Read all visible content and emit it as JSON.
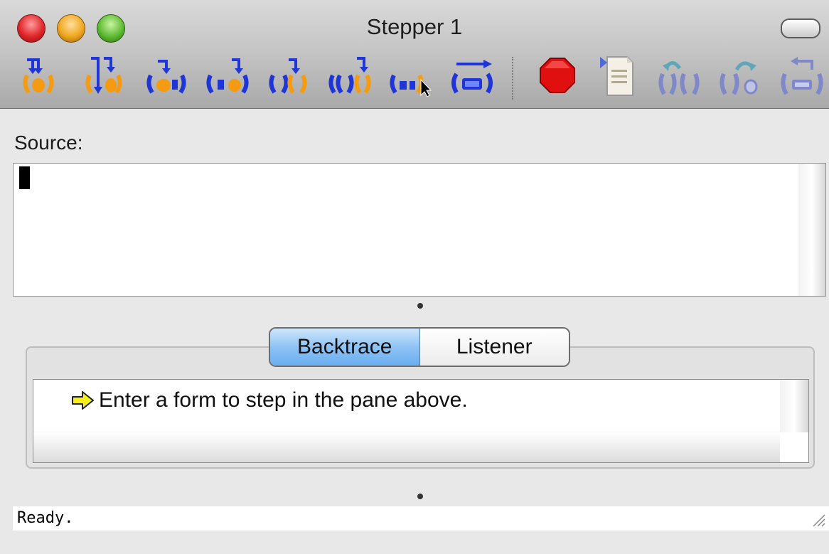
{
  "window": {
    "title": "Stepper 1"
  },
  "toolbar": {
    "buttons": [
      {
        "icon": "step-into-icon"
      },
      {
        "icon": "step-into-down-icon"
      },
      {
        "icon": "step-over-icon"
      },
      {
        "icon": "step-next-icon"
      },
      {
        "icon": "step-out-paren-icon"
      },
      {
        "icon": "step-out-double-paren-icon"
      },
      {
        "icon": "step-to-cursor-icon"
      },
      {
        "icon": "continue-icon"
      },
      {
        "icon": "stop-icon"
      },
      {
        "icon": "source-document-icon"
      },
      {
        "icon": "undo-step-icon"
      },
      {
        "icon": "redo-step-icon"
      },
      {
        "icon": "return-icon"
      }
    ]
  },
  "source": {
    "label": "Source:",
    "value": ""
  },
  "tabs": {
    "items": [
      "Backtrace",
      "Listener"
    ],
    "active": "Backtrace"
  },
  "backtrace": {
    "lines": [
      "Enter a form to step in the pane above."
    ]
  },
  "status": {
    "text": "Ready."
  },
  "colors": {
    "step_blue": "#1f35d8",
    "step_orange": "#f59b12",
    "disabled_blue": "#7f88c8",
    "stop_red": "#e01010",
    "tab_active": "#8fc3f4",
    "arrow_yellow": "#f6ee1c"
  }
}
